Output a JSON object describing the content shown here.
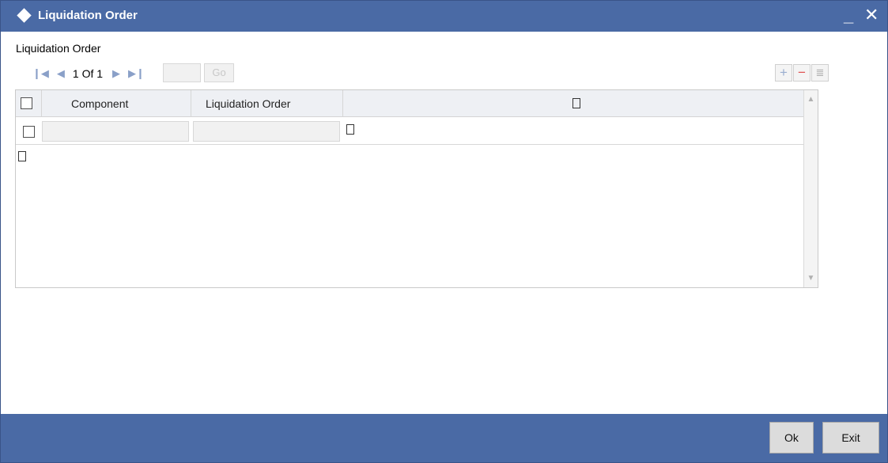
{
  "window": {
    "title": "Liquidation Order",
    "minimize_glyph": "_",
    "close_glyph": "✕"
  },
  "section": {
    "title": "Liquidation Order"
  },
  "navigation": {
    "first_glyph": "❙◀",
    "prev_glyph": "◀",
    "page_text": "1 Of 1",
    "next_glyph": "▶",
    "last_glyph": "▶❙",
    "page_input_value": "",
    "go_label": "Go"
  },
  "grid_actions": {
    "add_glyph": "+",
    "delete_glyph": "−",
    "view_glyph": "≣"
  },
  "table": {
    "columns": [
      "Component",
      "Liquidation Order"
    ],
    "rows": [
      {
        "component": "",
        "liquidation_order": ""
      }
    ]
  },
  "scrollbar": {
    "up_glyph": "▲",
    "down_glyph": "▼"
  },
  "footer": {
    "ok_label": "Ok",
    "exit_label": "Exit"
  },
  "colors": {
    "titlebar": "#4a6aa5",
    "footer": "#4a6aa5",
    "header_bg": "#eef0f4"
  }
}
